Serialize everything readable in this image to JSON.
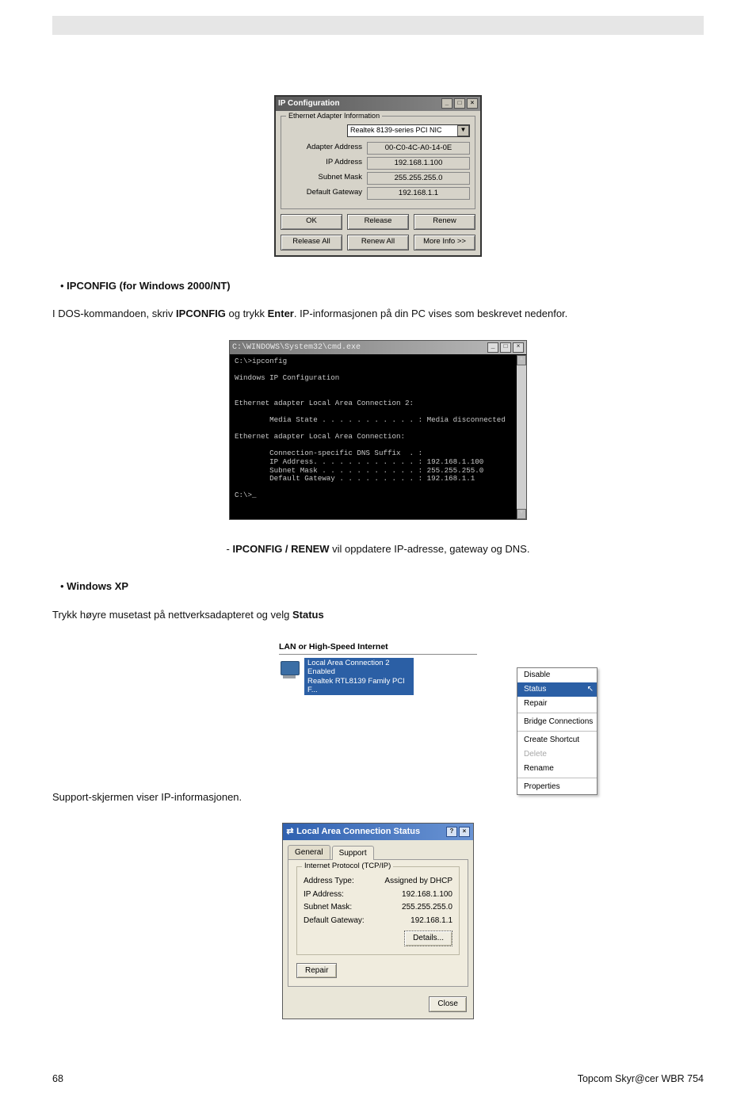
{
  "page": {
    "number": "68",
    "footer_right": "Topcom Skyr@cer WBR 754"
  },
  "doc": {
    "ipconfig_heading": "IPCONFIG (for Windows 2000/NT)",
    "ipconfig_para_pre": "I DOS-kommandoen, skriv ",
    "ipconfig_cmd": "IPCONFIG",
    "ipconfig_para_mid": " og trykk ",
    "ipconfig_enter": "Enter",
    "ipconfig_para_post": ". IP-informasjonen på din PC vises som beskrevet nedenfor.",
    "renew_pre": "- ",
    "renew_bold": "IPCONFIG / RENEW",
    "renew_post": " vil oppdatere IP-adresse, gateway og DNS.",
    "winxp_heading": "Windows XP",
    "winxp_para_pre": "Trykk høyre musetast på nettverksadapteret og velg ",
    "winxp_status": "Status",
    "support_line": "Support-skjermen viser IP-informasjonen."
  },
  "ipwin": {
    "title": "IP Configuration",
    "group": "Ethernet Adapter Information",
    "nic": "Realtek 8139-series PCI NIC",
    "rows": {
      "adapter_label": "Adapter Address",
      "adapter_value": "00-C0-4C-A0-14-0E",
      "ip_label": "IP Address",
      "ip_value": "192.168.1.100",
      "subnet_label": "Subnet Mask",
      "subnet_value": "255.255.255.0",
      "gateway_label": "Default Gateway",
      "gateway_value": "192.168.1.1"
    },
    "buttons": {
      "ok": "OK",
      "release": "Release",
      "renew": "Renew",
      "release_all": "Release All",
      "renew_all": "Renew All",
      "more_info": "More Info >>"
    }
  },
  "cmd": {
    "title": "C:\\WINDOWS\\System32\\cmd.exe",
    "l1": "C:\\>ipconfig",
    "l2": "Windows IP Configuration",
    "l3": "Ethernet adapter Local Area Connection 2:",
    "l4": "        Media State . . . . . . . . . . . : Media disconnected",
    "l5": "Ethernet adapter Local Area Connection:",
    "l6": "        Connection-specific DNS Suffix  . :",
    "l7": "        IP Address. . . . . . . . . . . . : 192.168.1.100",
    "l8": "        Subnet Mask . . . . . . . . . . . : 255.255.255.0",
    "l9": "        Default Gateway . . . . . . . . . : 192.168.1.1",
    "l10": "C:\\>_"
  },
  "xp": {
    "heading": "LAN or High-Speed Internet",
    "sel1": "Local Area Connection 2",
    "sel2": "Enabled",
    "sel3": "Realtek RTL8139 Family PCI F...",
    "menu": {
      "disable": "Disable",
      "status": "Status",
      "repair": "Repair",
      "bridge": "Bridge Connections",
      "shortcut": "Create Shortcut",
      "delete": "Delete",
      "rename": "Rename",
      "properties": "Properties"
    }
  },
  "status": {
    "title": "Local Area Connection Status",
    "tab_general": "General",
    "tab_support": "Support",
    "group": "Internet Protocol (TCP/IP)",
    "rows": {
      "type_l": "Address Type:",
      "type_v": "Assigned by DHCP",
      "ip_l": "IP Address:",
      "ip_v": "192.168.1.100",
      "subnet_l": "Subnet Mask:",
      "subnet_v": "255.255.255.0",
      "gw_l": "Default Gateway:",
      "gw_v": "192.168.1.1"
    },
    "details": "Details...",
    "repair": "Repair",
    "close": "Close"
  }
}
